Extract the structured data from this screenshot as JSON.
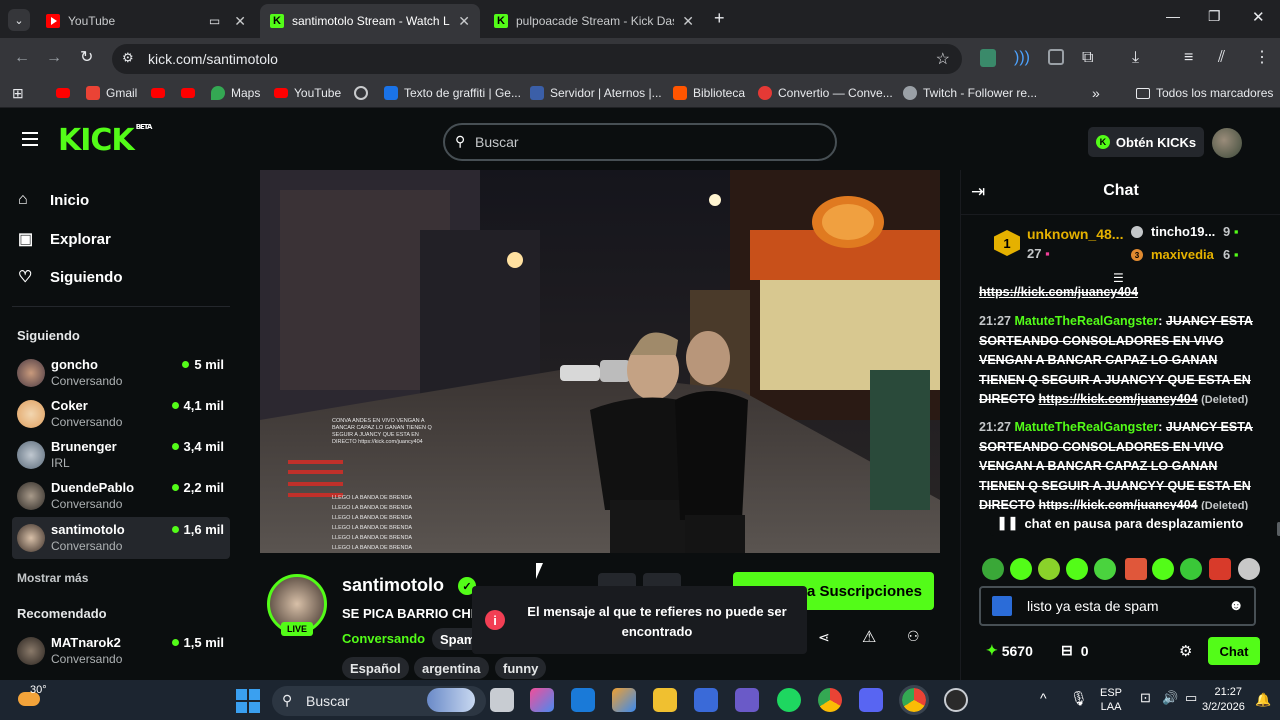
{
  "browser": {
    "tabs": [
      {
        "title": "YouTube",
        "favicon": "youtube-favicon"
      },
      {
        "title": "santimotolo Stream - Watch Live",
        "favicon": "kick-favicon"
      },
      {
        "title": "pulpoacade Stream - Kick Dashboard",
        "favicon": "kick-favicon"
      }
    ],
    "new_tab": "+",
    "url": "kick.com/santimotolo",
    "bookmarks": [
      "Gmail",
      "Maps",
      "YouTube",
      "Texto de graffiti | Ge...",
      "Servidor | Aternos |...",
      "Biblioteca",
      "Convertio — Conve...",
      "Twitch - Follower re..."
    ],
    "all_bookmarks": "Todos los marcadores"
  },
  "kick": {
    "logo": "KICK",
    "logo_badge": "BETA",
    "search_placeholder": "Buscar",
    "get_kicks": "Obtén KICKs"
  },
  "sidebar": {
    "nav": [
      {
        "label": "Inicio",
        "icon": "home-icon"
      },
      {
        "label": "Explorar",
        "icon": "browse-icon"
      },
      {
        "label": "Siguiendo",
        "icon": "heart-icon"
      }
    ],
    "following_title": "Siguiendo",
    "following": [
      {
        "name": "goncho",
        "category": "Conversando",
        "viewers": "5 mil"
      },
      {
        "name": "Coker",
        "category": "Conversando",
        "viewers": "4,1 mil"
      },
      {
        "name": "Brunenger",
        "category": "IRL",
        "viewers": "3,4 mil"
      },
      {
        "name": "DuendePablo",
        "category": "Conversando",
        "viewers": "2,2 mil"
      },
      {
        "name": "santimotolo",
        "category": "Conversando",
        "viewers": "1,6 mil"
      }
    ],
    "show_more": "Mostrar más",
    "recommended_title": "Recomendado",
    "recommended": [
      {
        "name": "MATnarok2",
        "category": "Conversando",
        "viewers": "1,5 mil"
      }
    ]
  },
  "stream": {
    "channel": "santimotolo",
    "live_badge": "LIVE",
    "title": "SE PICA BARRIO CHI",
    "category": "Conversando",
    "tags": [
      "Español",
      "argentina",
      "funny"
    ],
    "subscribe_label": "a Suscripciones",
    "spam_label": "Spam",
    "overlay_lines": [
      "LLEGO LA BANDA DE BRENDA",
      "LLEGO LA BANDA DE BRENDA",
      "LLEGO LA BANDA DE BRENDA",
      "LLEGO LA BANDA DE BRENDA",
      "LLEGO LA BANDA DE BRENDA",
      "LLEGO LA BANDA DE BRENDA"
    ]
  },
  "toast": {
    "message": "El mensaje al que te refieres no puede ser encontrado"
  },
  "chat": {
    "title": "Chat",
    "leaderboard": {
      "first": {
        "rank": "1",
        "name": "unknown_48...",
        "count": "27"
      },
      "second": {
        "name": "tincho19...",
        "count": "9"
      },
      "third": {
        "rank": "3",
        "name": "maxivedia",
        "count": "6"
      }
    },
    "top_link": "https://kick.com/juancy404",
    "messages": [
      {
        "time": "21:27",
        "user": "MatuteTheRealGangster",
        "text": "JUANCY ESTA SORTEANDO CONSOLADORES EN VIVO VENGAN A BANCAR CAPAZ LO GANAN TIENEN Q SEGUIR A JUANCYY QUE ESTA EN DIRECTO",
        "link": "https://kick.com/juancy404",
        "deleted": "(Deleted)"
      },
      {
        "time": "21:27",
        "user": "MatuteTheRealGangster",
        "text": "JUANCY ESTA SORTEANDO CONSOLADORES EN VIVO VENGAN A BANCAR CAPAZ LO GANAN TIENEN Q SEGUIR A JUANCYY QUE ESTA EN DIRECTO",
        "link": "https://kick.com/juancy404",
        "deleted": "(Deleted)"
      }
    ],
    "paused_notice": "chat en pausa para desplazamiento",
    "input_value": "listo ya esta de spam",
    "points": "5670",
    "gifts": "0",
    "send_label": "Chat"
  },
  "taskbar": {
    "weather": "30°",
    "search": "Buscar",
    "lang": "ESP",
    "lang2": "LAA",
    "time": "21:27",
    "date": "3/2/2026"
  }
}
